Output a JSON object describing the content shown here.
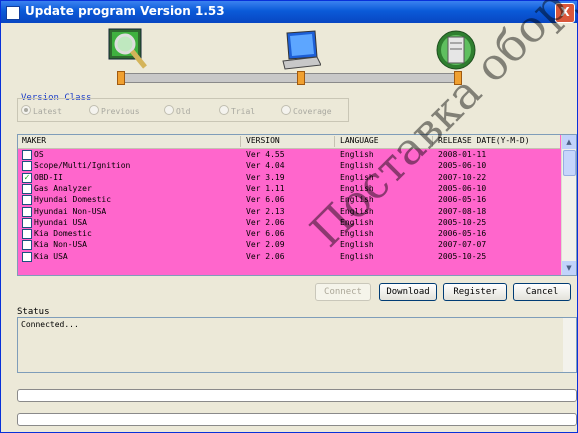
{
  "window": {
    "title": "Update program Version 1.53",
    "close_label": "X"
  },
  "steps": [
    {
      "icon": "magnifier-screen-icon"
    },
    {
      "icon": "laptop-icon"
    },
    {
      "icon": "globe-server-icon"
    }
  ],
  "version_class": {
    "label": "Version Class",
    "options": [
      {
        "label": "Latest",
        "selected": true
      },
      {
        "label": "Previous",
        "selected": false
      },
      {
        "label": "Old",
        "selected": false
      },
      {
        "label": "Trial",
        "selected": false
      },
      {
        "label": "Coverage",
        "selected": false
      }
    ]
  },
  "table": {
    "columns": [
      "MAKER",
      "VERSION",
      "LANGUAGE",
      "RELEASE DATE(Y-M-D)"
    ],
    "rows": [
      {
        "checked": false,
        "maker": "OS",
        "version": "Ver 4.55",
        "language": "English",
        "date": "2008-01-11"
      },
      {
        "checked": false,
        "maker": "Scope/Multi/Ignition",
        "version": "Ver 4.04",
        "language": "English",
        "date": "2005-06-10"
      },
      {
        "checked": true,
        "maker": "OBD-II",
        "version": "Ver 3.19",
        "language": "English",
        "date": "2007-10-22"
      },
      {
        "checked": false,
        "maker": "Gas Analyzer",
        "version": "Ver 1.11",
        "language": "English",
        "date": "2005-06-10"
      },
      {
        "checked": false,
        "maker": "Hyundai Domestic",
        "version": "Ver 6.06",
        "language": "English",
        "date": "2006-05-16"
      },
      {
        "checked": false,
        "maker": "Hyundai Non-USA",
        "version": "Ver 2.13",
        "language": "English",
        "date": "2007-08-18"
      },
      {
        "checked": false,
        "maker": "Hyundai USA",
        "version": "Ver 2.06",
        "language": "English",
        "date": "2005-10-25"
      },
      {
        "checked": false,
        "maker": "Kia Domestic",
        "version": "Ver 6.06",
        "language": "English",
        "date": "2006-05-16"
      },
      {
        "checked": false,
        "maker": "Kia Non-USA",
        "version": "Ver 2.09",
        "language": "English",
        "date": "2007-07-07"
      },
      {
        "checked": false,
        "maker": "Kia USA",
        "version": "Ver 2.06",
        "language": "English",
        "date": "2005-10-25"
      }
    ],
    "check_mark": "✓"
  },
  "buttons": {
    "connect": "Connect",
    "download": "Download",
    "register": "Register",
    "cancel": "Cancel"
  },
  "status": {
    "label": "Status",
    "text": "Connected..."
  },
  "progress": [
    {
      "value": 0
    },
    {
      "value": 0
    }
  ],
  "watermark": "Поставка оборуд",
  "colors": {
    "row_highlight": "#ff66cc",
    "title_bar": "#0a5ad8",
    "accent": "#1a3cc8"
  }
}
